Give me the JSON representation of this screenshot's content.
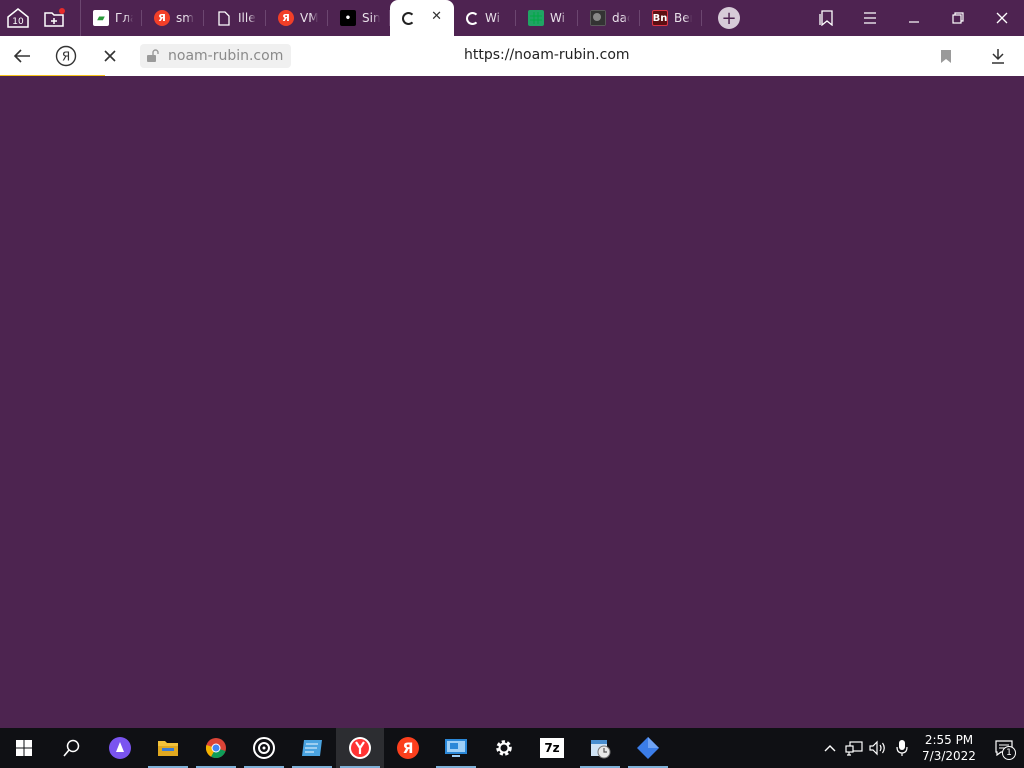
{
  "tabstrip": {
    "home_badge": "10",
    "tabs": [
      {
        "title": "Гла",
        "icon": "green-leaf-icon"
      },
      {
        "title": "sm",
        "icon": "yandex-icon"
      },
      {
        "title": "Ille",
        "icon": "document-icon"
      },
      {
        "title": "VM",
        "icon": "yandex-icon"
      },
      {
        "title": "Sin",
        "icon": "dark-site-icon"
      },
      {
        "title": "",
        "icon": "loading-spinner-icon",
        "active": true
      },
      {
        "title": "Wi",
        "icon": "loading-spinner-icon"
      },
      {
        "title": "Wi",
        "icon": "spreadsheet-icon"
      },
      {
        "title": "dac",
        "icon": "image-icon"
      },
      {
        "title": "Ber",
        "icon": "bn-icon"
      }
    ],
    "new_tab_label": "+"
  },
  "addressbar": {
    "site_domain": "noam-rubin.com",
    "url": "https://noam-rubin.com",
    "yandex_glyph": "Я"
  },
  "taskbar": {
    "apps": [
      {
        "name": "alice"
      },
      {
        "name": "file-explorer"
      },
      {
        "name": "chrome"
      },
      {
        "name": "media"
      },
      {
        "name": "notes"
      },
      {
        "name": "yandex-browser"
      },
      {
        "name": "yandex"
      },
      {
        "name": "remote-desktop"
      },
      {
        "name": "settings"
      },
      {
        "name": "7zip",
        "label": "7z"
      },
      {
        "name": "calendar-tool"
      },
      {
        "name": "blue-app"
      }
    ],
    "clock_time": "2:55 PM",
    "clock_date": "7/3/2022",
    "notification_count": "1"
  },
  "colors": {
    "page_background": "#4d2450",
    "tabstrip_background": "#4e2351",
    "progress_bar": "#f8c41b",
    "taskbar_background": "#0f1014"
  }
}
